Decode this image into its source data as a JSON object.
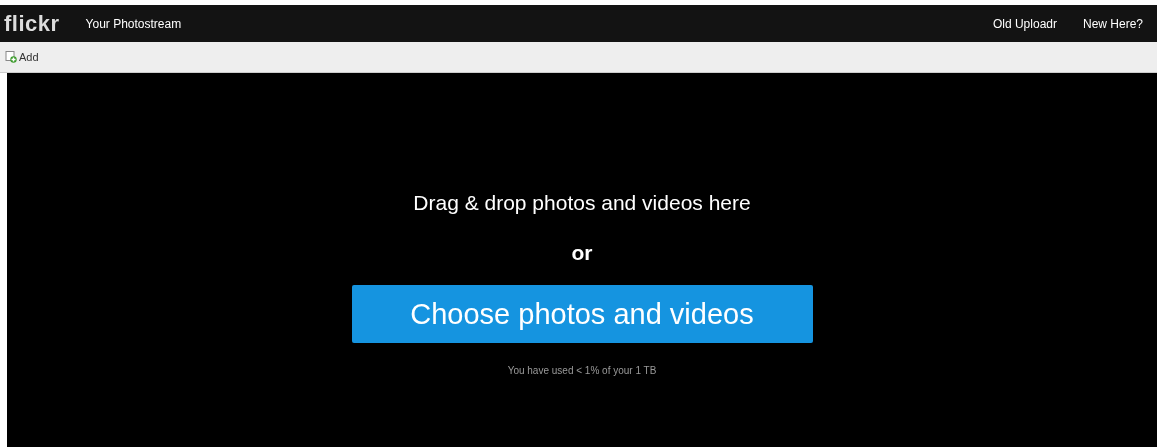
{
  "navbar": {
    "logo": "flickr",
    "links": [
      {
        "label": "Your Photostream"
      }
    ],
    "right_links": [
      {
        "label": "Old Uploadr"
      },
      {
        "label": "New Here?"
      }
    ]
  },
  "toolbar": {
    "add_button": "Add"
  },
  "dropzone": {
    "heading": "Drag & drop photos and videos here",
    "separator": "or",
    "button": "Choose photos and videos",
    "usage": "You have used < 1% of your 1 TB"
  }
}
